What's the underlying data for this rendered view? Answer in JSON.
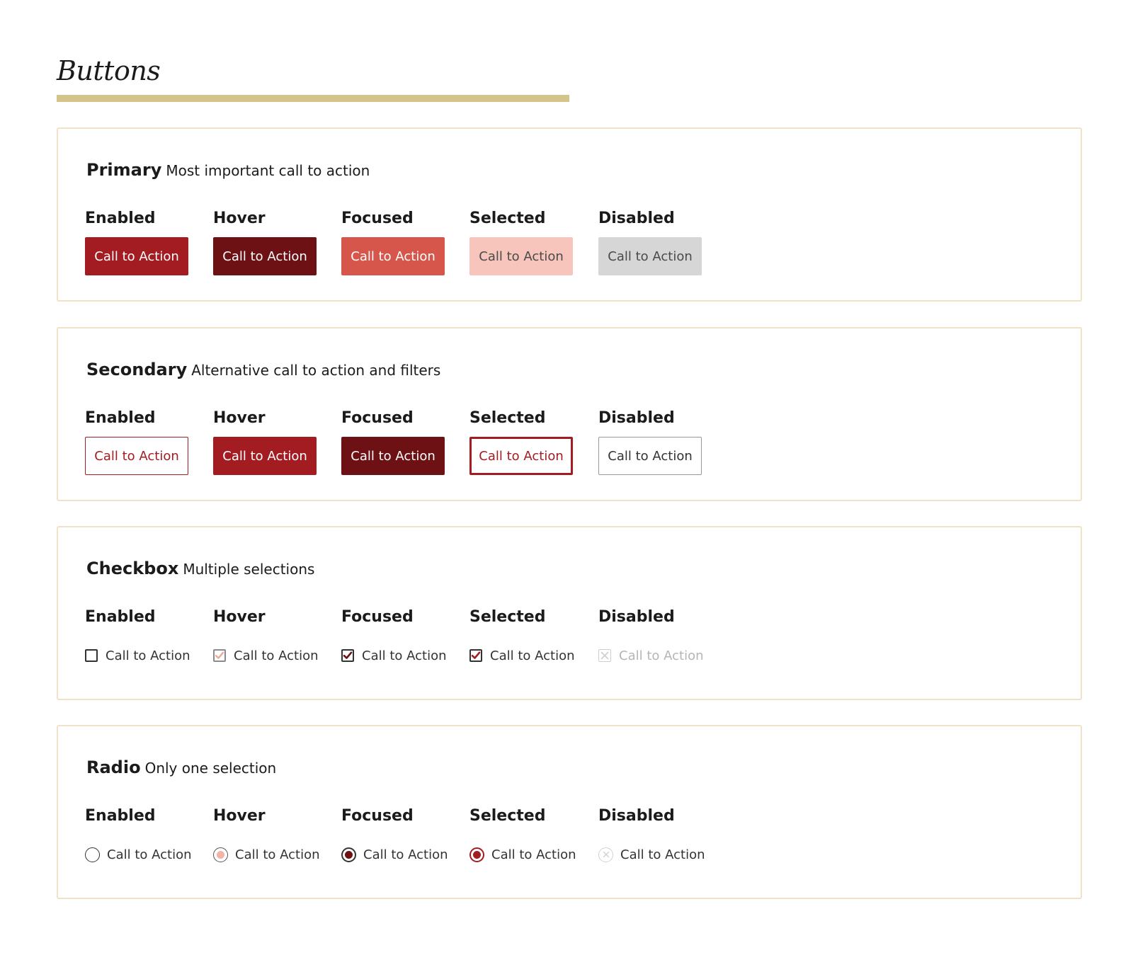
{
  "page": {
    "title": "Buttons"
  },
  "colors": {
    "accent_bar": "#d4c48a",
    "panel_border": "#f0e2c9",
    "brand_red": "#a31c22",
    "dark_red": "#6e1114",
    "focus_coral": "#d6564b",
    "selected_pink": "#f7c5bc",
    "disabled_gray": "#d6d6d6"
  },
  "sections": {
    "primary": {
      "name": "Primary",
      "description": "Most important call to action",
      "states": {
        "enabled": {
          "label": "Enabled",
          "text": "Call to Action"
        },
        "hover": {
          "label": "Hover",
          "text": "Call to Action"
        },
        "focused": {
          "label": "Focused",
          "text": "Call to Action"
        },
        "selected": {
          "label": "Selected",
          "text": "Call to Action"
        },
        "disabled": {
          "label": "Disabled",
          "text": "Call to Action"
        }
      }
    },
    "secondary": {
      "name": "Secondary",
      "description": "Alternative call to action and filters",
      "states": {
        "enabled": {
          "label": "Enabled",
          "text": "Call to Action"
        },
        "hover": {
          "label": "Hover",
          "text": "Call to Action"
        },
        "focused": {
          "label": "Focused",
          "text": "Call to Action"
        },
        "selected": {
          "label": "Selected",
          "text": "Call to Action"
        },
        "disabled": {
          "label": "Disabled",
          "text": "Call to Action"
        }
      }
    },
    "checkbox": {
      "name": "Checkbox",
      "description": "Multiple selections",
      "states": {
        "enabled": {
          "label": "Enabled",
          "text": "Call to Action",
          "icon": "checkbox-empty-icon"
        },
        "hover": {
          "label": "Hover",
          "text": "Call to Action",
          "icon": "checkbox-hover-check-icon"
        },
        "focused": {
          "label": "Focused",
          "text": "Call to Action",
          "icon": "checkbox-checked-icon"
        },
        "selected": {
          "label": "Selected",
          "text": "Call to Action",
          "icon": "checkbox-checked-icon"
        },
        "disabled": {
          "label": "Disabled",
          "text": "Call to Action",
          "icon": "checkbox-disabled-x-icon"
        }
      }
    },
    "radio": {
      "name": "Radio",
      "description": "Only one selection",
      "states": {
        "enabled": {
          "label": "Enabled",
          "text": "Call to Action",
          "icon": "radio-empty-icon"
        },
        "hover": {
          "label": "Hover",
          "text": "Call to Action",
          "icon": "radio-hover-dot-icon"
        },
        "focused": {
          "label": "Focused",
          "text": "Call to Action",
          "icon": "radio-checked-icon"
        },
        "selected": {
          "label": "Selected",
          "text": "Call to Action",
          "icon": "radio-checked-icon"
        },
        "disabled": {
          "label": "Disabled",
          "text": "Call to Action",
          "icon": "radio-disabled-x-icon"
        }
      }
    }
  }
}
